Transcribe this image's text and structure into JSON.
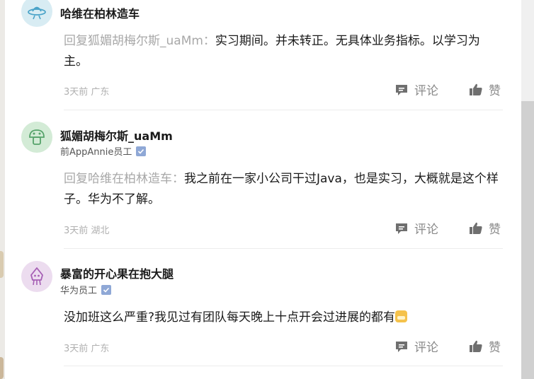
{
  "comments": [
    {
      "name": "哈维在柏林造车",
      "title": "",
      "reply_prefix": "回复狐媚胡梅尔斯_uaMm：",
      "text": "实习期间。并未转正。无具体业务指标。以学习为主。",
      "time_location": "3天前 广东",
      "comment_label": "评论",
      "like_label": "赞",
      "avatar_icon": "ufo-icon",
      "avatar_color": "#d8ecf3"
    },
    {
      "name": "狐媚胡梅尔斯_uaMm",
      "title": "前AppAnnie员工",
      "reply_prefix": "回复哈维在柏林造车：",
      "text": "我之前在一家小公司干过Java，也是实习，大概就是这个样子。华为不了解。",
      "time_location": "3天前 湖北",
      "comment_label": "评论",
      "like_label": "赞",
      "avatar_icon": "mushroom-icon",
      "avatar_color": "#d3ebd6"
    },
    {
      "name": "暴富的开心果在抱大腿",
      "title": "华为员工",
      "reply_prefix": "",
      "text": "没加班这么严重?我见过有团队每天晚上十点开会过进展的都有",
      "time_location": "3天前 广东",
      "comment_label": "评论",
      "like_label": "赞",
      "avatar_icon": "squid-icon",
      "avatar_color": "#ecdcef"
    }
  ],
  "colors": {
    "verified_badge": "#8fa8d6",
    "muted_text": "#a8a8a8",
    "action_text": "#8a8a8a"
  }
}
